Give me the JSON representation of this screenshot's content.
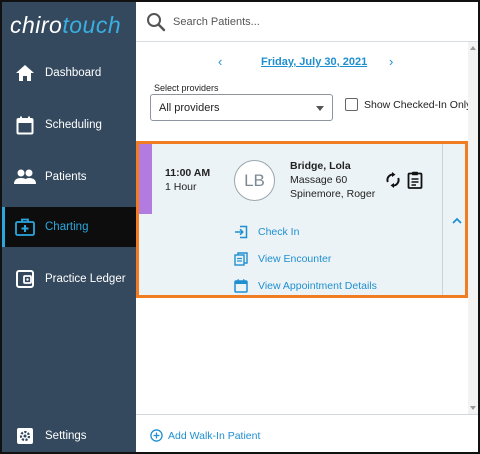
{
  "logo": {
    "part1": "chiro",
    "part2": "touch"
  },
  "sidebar": {
    "items": [
      {
        "label": "Dashboard"
      },
      {
        "label": "Scheduling"
      },
      {
        "label": "Patients"
      },
      {
        "label": "Charting"
      },
      {
        "label": "Practice Ledger"
      }
    ],
    "settings": "Settings"
  },
  "search": {
    "placeholder": "Search Patients..."
  },
  "date_nav": {
    "date": "Friday, July 30, 2021",
    "prev": "‹",
    "next": "›"
  },
  "providers": {
    "label": "Select providers",
    "selected": "All providers"
  },
  "show_checked_in": {
    "label": "Show Checked-In Only",
    "checked": false
  },
  "appointment": {
    "time": "11:00 AM",
    "duration": "1 Hour",
    "initials": "LB",
    "patient": "Bridge, Lola",
    "service": "Massage 60",
    "provider": "Spinemore, Roger",
    "actions": [
      {
        "label": "Check In"
      },
      {
        "label": "View Encounter"
      },
      {
        "label": "View Appointment Details"
      }
    ]
  },
  "footer": {
    "add_walkin": "Add Walk-In Patient"
  },
  "colors": {
    "sidebar": "#34495e",
    "accent": "#1f8fd0",
    "highlight": "#f07d22",
    "appointment_stripe": "#b27be0",
    "card_bg": "#ecf3f6"
  }
}
